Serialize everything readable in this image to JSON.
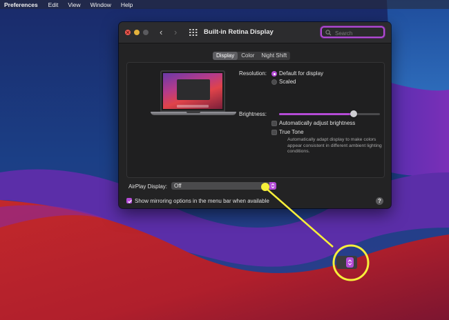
{
  "menubar": {
    "app": "Preferences",
    "items": [
      "Edit",
      "View",
      "Window",
      "Help"
    ]
  },
  "window": {
    "title": "Built-in Retina Display",
    "search_placeholder": "Search"
  },
  "tabs": [
    {
      "label": "Display",
      "active": true
    },
    {
      "label": "Color",
      "active": false
    },
    {
      "label": "Night Shift",
      "active": false
    }
  ],
  "display": {
    "resolution_label": "Resolution:",
    "resolution_options": [
      {
        "label": "Default for display",
        "selected": true
      },
      {
        "label": "Scaled",
        "selected": false
      }
    ],
    "brightness_label": "Brightness:",
    "brightness_level": 0.74,
    "auto_brightness": {
      "label": "Automatically adjust brightness",
      "checked": false
    },
    "true_tone": {
      "label": "True Tone",
      "checked": false
    },
    "true_tone_note": "Automatically adapt display to make colors appear consistent in different ambient lighting conditions."
  },
  "airplay": {
    "label": "AirPlay Display:",
    "value": "Off"
  },
  "mirroring": {
    "label": "Show mirroring options in the menu bar when available",
    "checked": true
  },
  "help_label": "?",
  "colors": {
    "accent": "#b44bd6",
    "highlight": "#f7ef3a"
  }
}
